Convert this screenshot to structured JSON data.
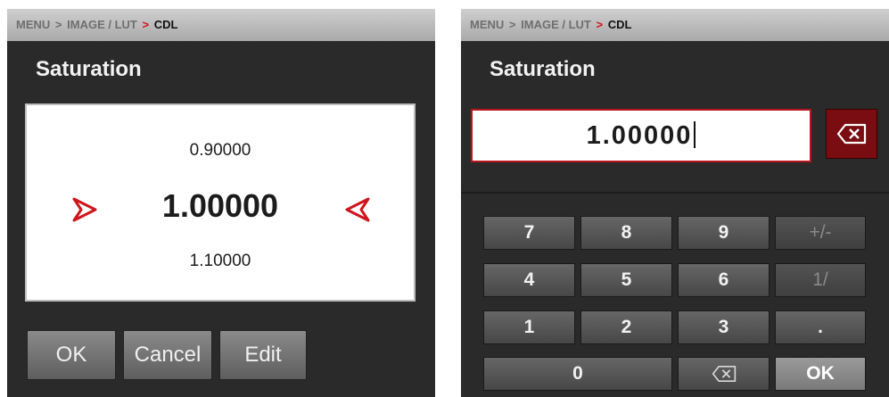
{
  "left_panel": {
    "breadcrumb": {
      "part1": "MENU",
      "part2": "IMAGE / LUT",
      "current": "CDL"
    },
    "title": "Saturation",
    "wheel": {
      "prev": "0.90000",
      "current": "1.00000",
      "next": "1.10000"
    },
    "buttons": {
      "ok": "OK",
      "cancel": "Cancel",
      "edit": "Edit"
    }
  },
  "right_panel": {
    "breadcrumb": {
      "part1": "MENU",
      "part2": "IMAGE / LUT",
      "current": "CDL"
    },
    "title": "Saturation",
    "entry_value": "1.00000",
    "keypad": {
      "row1": [
        "7",
        "8",
        "9",
        "+/-"
      ],
      "row2": [
        "4",
        "5",
        "6",
        "1/"
      ],
      "row3": [
        "1",
        "2",
        "3",
        "."
      ],
      "zero": "0",
      "ok": "OK"
    }
  },
  "colors": {
    "accent_red": "#d0141c",
    "panel_bg": "#2a2a2a"
  },
  "icons": {
    "arrow_left": "chevron-right-icon",
    "arrow_right": "chevron-left-icon",
    "delete": "backspace-icon"
  }
}
